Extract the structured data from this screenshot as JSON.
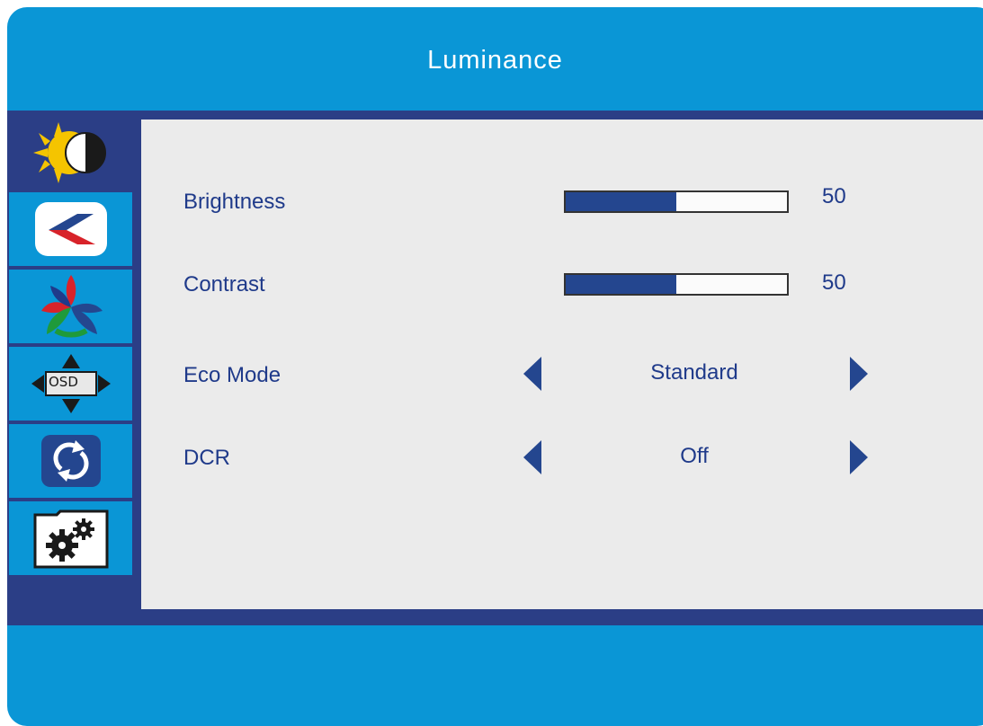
{
  "header": {
    "title": "Luminance"
  },
  "sidebar": {
    "items": [
      {
        "name": "luminance",
        "icon": "sun-half-moon-icon",
        "active": true
      },
      {
        "name": "image-setup",
        "icon": "image-setup-icon",
        "active": false
      },
      {
        "name": "color-temp",
        "icon": "color-tri-icon",
        "active": false
      },
      {
        "name": "osd-setup",
        "icon": "osd-icon",
        "label": "OSD",
        "active": false
      },
      {
        "name": "reset",
        "icon": "reset-icon",
        "active": false
      },
      {
        "name": "misc",
        "icon": "gears-folder-icon",
        "active": false
      }
    ]
  },
  "settings": {
    "brightness": {
      "label": "Brightness",
      "value": "50",
      "fill_fraction": 0.5
    },
    "contrast": {
      "label": "Contrast",
      "value": "50",
      "fill_fraction": 0.5
    },
    "eco_mode": {
      "label": "Eco Mode",
      "value": "Standard"
    },
    "dcr": {
      "label": "DCR",
      "value": "Off"
    }
  },
  "colors": {
    "frame": "#0a96d6",
    "band": "#2b3e86",
    "panel": "#ebebeb",
    "text": "#1f3a8a",
    "bar_fill": "#24468f"
  }
}
